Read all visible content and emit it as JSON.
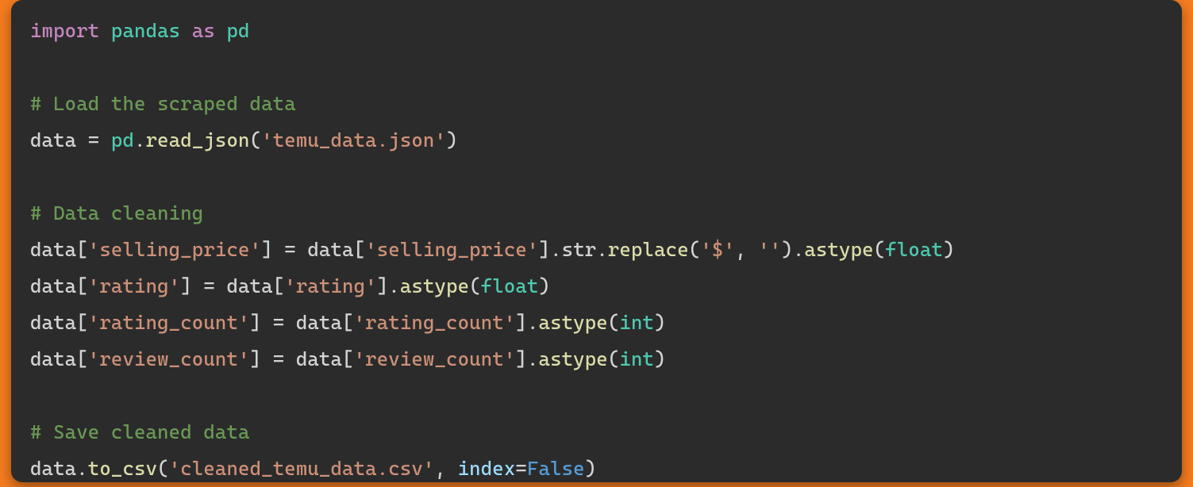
{
  "code": {
    "line1": {
      "import": "import",
      "module": "pandas",
      "as": "as",
      "alias": "pd"
    },
    "blank1": "",
    "comment_load": "# Load the scraped data",
    "line2": {
      "lhs": "data",
      "eq": " = ",
      "mod": "pd",
      "dot1": ".",
      "fn": "read_json",
      "op": "(",
      "arg_str": "'temu_data.json'",
      "cp": ")"
    },
    "blank2": "",
    "comment_clean": "# Data cleaning",
    "line3": {
      "lhs": "data",
      "bo1": "[",
      "key1": "'selling_price'",
      "bc1": "]",
      "eq": " = ",
      "rhs": "data",
      "bo2": "[",
      "key2": "'selling_price'",
      "bc2": "]",
      "dot1": ".",
      "attr1": "str",
      "dot2": ".",
      "fn1": "replace",
      "op1": "(",
      "arg1": "'$'",
      "comma": ", ",
      "arg2": "''",
      "cp1": ")",
      "dot3": ".",
      "fn2": "astype",
      "op2": "(",
      "type": "float",
      "cp2": ")"
    },
    "line4": {
      "lhs": "data",
      "bo1": "[",
      "key1": "'rating'",
      "bc1": "]",
      "eq": " = ",
      "rhs": "data",
      "bo2": "[",
      "key2": "'rating'",
      "bc2": "]",
      "dot": ".",
      "fn": "astype",
      "op": "(",
      "type": "float",
      "cp": ")"
    },
    "line5": {
      "lhs": "data",
      "bo1": "[",
      "key1": "'rating_count'",
      "bc1": "]",
      "eq": " = ",
      "rhs": "data",
      "bo2": "[",
      "key2": "'rating_count'",
      "bc2": "]",
      "dot": ".",
      "fn": "astype",
      "op": "(",
      "type": "int",
      "cp": ")"
    },
    "line6": {
      "lhs": "data",
      "bo1": "[",
      "key1": "'review_count'",
      "bc1": "]",
      "eq": " = ",
      "rhs": "data",
      "bo2": "[",
      "key2": "'review_count'",
      "bc2": "]",
      "dot": ".",
      "fn": "astype",
      "op": "(",
      "type": "int",
      "cp": ")"
    },
    "blank3": "",
    "comment_save": "# Save cleaned data",
    "line7": {
      "obj": "data",
      "dot": ".",
      "fn": "to_csv",
      "op": "(",
      "arg_str": "'cleaned_temu_data.csv'",
      "comma": ", ",
      "kwarg": "index",
      "assign": "=",
      "val": "False",
      "cp": ")"
    }
  }
}
